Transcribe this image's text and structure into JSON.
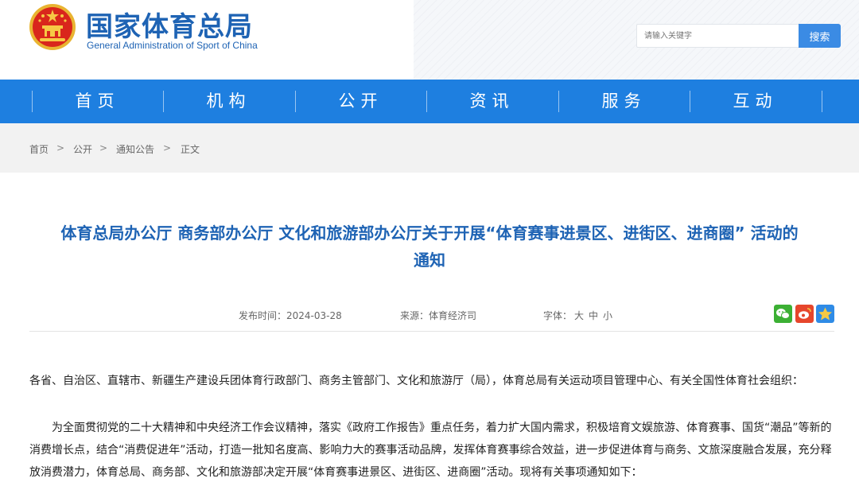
{
  "header": {
    "title": "国家体育总局",
    "subtitle": "General Administration of Sport of China",
    "search_placeholder": "请输入关键字",
    "search_button": "搜索",
    "emblem_icon": "national-emblem-icon"
  },
  "nav": {
    "items": [
      "首页",
      "机构",
      "公开",
      "资讯",
      "服务",
      "互动"
    ]
  },
  "breadcrumb": {
    "items": [
      "首页",
      "公开",
      "通知公告",
      "正文"
    ],
    "separator": ">"
  },
  "article": {
    "title_line1": "体育总局办公厅 商务部办公厅 文化和旅游部办公厅关于开展“体育赛事进景区、进街区、进商圈” 活动的",
    "title_line2": "通知",
    "publish_time": "发布时间：2024-03-28",
    "source": "来源：体育经济司",
    "font_label": "字体：",
    "font_sizes": [
      "大",
      "中",
      "小"
    ],
    "share_icons": [
      "wechat-icon",
      "weibo-icon",
      "qzone-icon"
    ],
    "para1": "各省、自治区、直辖市、新疆生产建设兵团体育行政部门、商务主管部门、文化和旅游厅（局），体育总局有关运动项目管理中心、有关全国性体育社会组织：",
    "para2": "为全面贯彻党的二十大精神和中央经济工作会议精神，落实《政府工作报告》重点任务，着力扩大国内需求，积极培育文娱旅游、体育赛事、国货“潮品”等新的消费增长点，结合“消费促进年”活动，打造一批知名度高、影响力大的赛事活动品牌，发挥体育赛事综合效益，进一步促进体育与商务、文旅深度融合发展，充分释放消费潜力，体育总局、商务部、文化和旅游部决定开展“体育赛事进景区、进街区、进商圈”活动。现将有关事项通知如下："
  },
  "colors": {
    "brand_blue": "#1e63b4",
    "nav_blue": "#1e7fe0",
    "search_button": "#3b8be4"
  }
}
